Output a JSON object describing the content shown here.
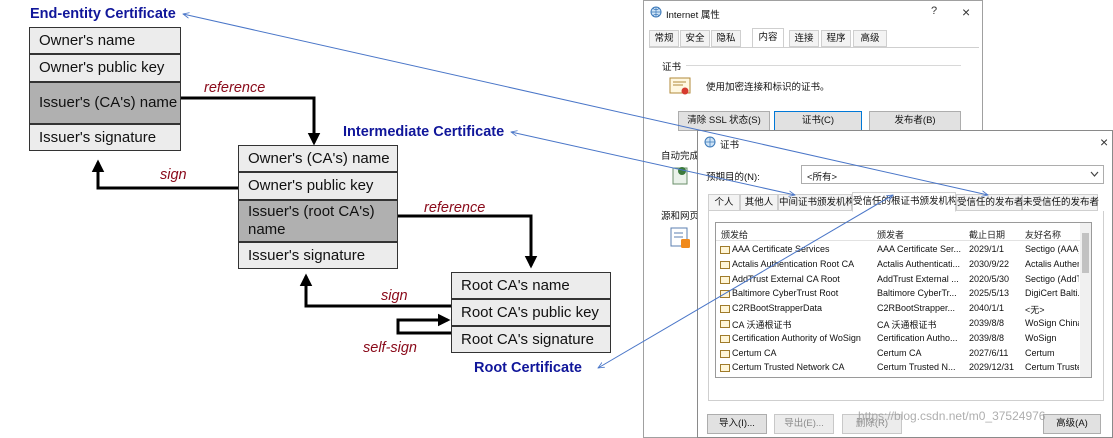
{
  "diagram": {
    "end_entity_title": "End-entity Certificate",
    "intermediate_title": "Intermediate Certificate",
    "root_title": "Root Certificate",
    "end_entity_fields": [
      "Owner's name",
      "Owner's public key",
      "Issuer's (CA's) name",
      "Issuer's signature"
    ],
    "intermediate_fields": [
      "Owner's (CA's) name",
      "Owner's public key",
      "Issuer's (root CA's) name",
      "Issuer's signature"
    ],
    "root_fields": [
      "Root CA's name",
      "Root CA's public key",
      "Root CA's signature"
    ],
    "labels": {
      "reference": "reference",
      "sign": "sign",
      "self_sign": "self-sign"
    },
    "colors": {
      "title_blue": "#10169a",
      "label_red": "#8a0a1a",
      "pointer_blue": "#4a76c8"
    }
  },
  "internet_window": {
    "title": "Internet 属性",
    "help": "?",
    "close": "×",
    "tabs": [
      "常规",
      "安全",
      "隐私",
      "内容",
      "连接",
      "程序",
      "高级"
    ],
    "active_tab": "内容",
    "section": "证书",
    "description": "使用加密连接和标识的证书。",
    "buttons": [
      "清除 SSL 状态(S)",
      "证书(C)",
      "发布者(B)"
    ],
    "autocomplete": "自动完成",
    "feeds": "源和网页"
  },
  "cert_window": {
    "title": "证书",
    "purpose_label": "预期目的(N):",
    "purpose_value": "<所有>",
    "tabs": [
      "个人",
      "其他人",
      "中间证书颁发机构",
      "受信任的根证书颁发机构",
      "受信任的发布者",
      "未受信任的发布者"
    ],
    "active_tab": "受信任的根证书颁发机构",
    "columns": [
      "颁发给",
      "颁发者",
      "截止日期",
      "友好名称"
    ],
    "rows": [
      [
        "AAA Certificate Services",
        "AAA Certificate Ser...",
        "2029/1/1",
        "Sectigo (AAA)"
      ],
      [
        "Actalis Authentication Root CA",
        "Actalis Authenticati...",
        "2030/9/22",
        "Actalis Authen"
      ],
      [
        "AddTrust External CA Root",
        "AddTrust External ...",
        "2020/5/30",
        "Sectigo (AddT"
      ],
      [
        "Baltimore CyberTrust Root",
        "Baltimore CyberTr...",
        "2025/5/13",
        "DigiCert Balti..."
      ],
      [
        "C2RBootStrapperData",
        "C2RBootStrapper...",
        "2040/1/1",
        "<无>"
      ],
      [
        "CA 沃通根证书",
        "CA 沃通根证书",
        "2039/8/8",
        "WoSign China"
      ],
      [
        "Certification Authority of WoSign",
        "Certification Autho...",
        "2039/8/8",
        "WoSign"
      ],
      [
        "Certum CA",
        "Certum CA",
        "2027/6/11",
        "Certum"
      ],
      [
        "Certum Trusted Network CA",
        "Certum Trusted N...",
        "2029/12/31",
        "Certum Truste"
      ]
    ],
    "buttons": [
      "导入(I)...",
      "导出(E)...",
      "删除(R)",
      "高级(A)"
    ]
  },
  "watermark": "https://blog.csdn.net/m0_37524976"
}
